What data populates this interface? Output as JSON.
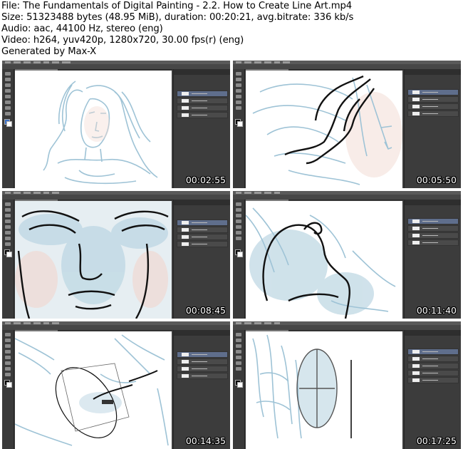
{
  "header": {
    "file_line": "File: The Fundamentals of Digital Painting - 2.2. How to Create Line Art.mp4",
    "size_line": "Size: 51323488 bytes (48.95 MiB), duration: 00:20:21, avg.bitrate: 336 kb/s",
    "audio_line": "Audio: aac, 44100 Hz, stereo (eng)",
    "video_line": "Video: h264, yuv420p, 1280x720, 30.00 fps(r) (eng)",
    "generated_line": "Generated by Max-X"
  },
  "thumbnails": [
    {
      "timestamp": "00:02:55",
      "content": "face-sketch"
    },
    {
      "timestamp": "00:05:50",
      "content": "hair-lines"
    },
    {
      "timestamp": "00:08:45",
      "content": "face-closeup"
    },
    {
      "timestamp": "00:11:40",
      "content": "shoulder-lines"
    },
    {
      "timestamp": "00:14:35",
      "content": "ellipse-selection"
    },
    {
      "timestamp": "00:17:25",
      "content": "shield-figure"
    }
  ],
  "colors": {
    "sketch": "#9ec3d6",
    "ink": "#111111",
    "ui_dark": "#3b3b3b",
    "timestamp_text": "#ffffff"
  }
}
